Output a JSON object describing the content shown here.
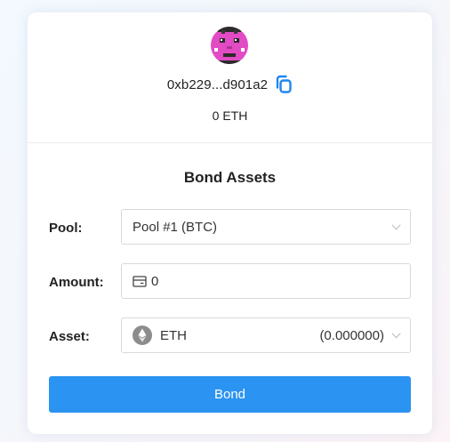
{
  "account": {
    "address": "0xb229...d901a2",
    "balance": "0 ETH",
    "avatar_icon": "pixel-avatar",
    "copy_icon": "copy-icon"
  },
  "form": {
    "title": "Bond Assets",
    "pool": {
      "label": "Pool:",
      "value": "Pool #1 (BTC)"
    },
    "amount": {
      "label": "Amount:",
      "value": "0"
    },
    "asset": {
      "label": "Asset:",
      "value": "ETH",
      "balance": "(0.000000)"
    },
    "submit_label": "Bond"
  },
  "colors": {
    "accent": "#2b93f1",
    "avatar": "#e24bc4"
  }
}
